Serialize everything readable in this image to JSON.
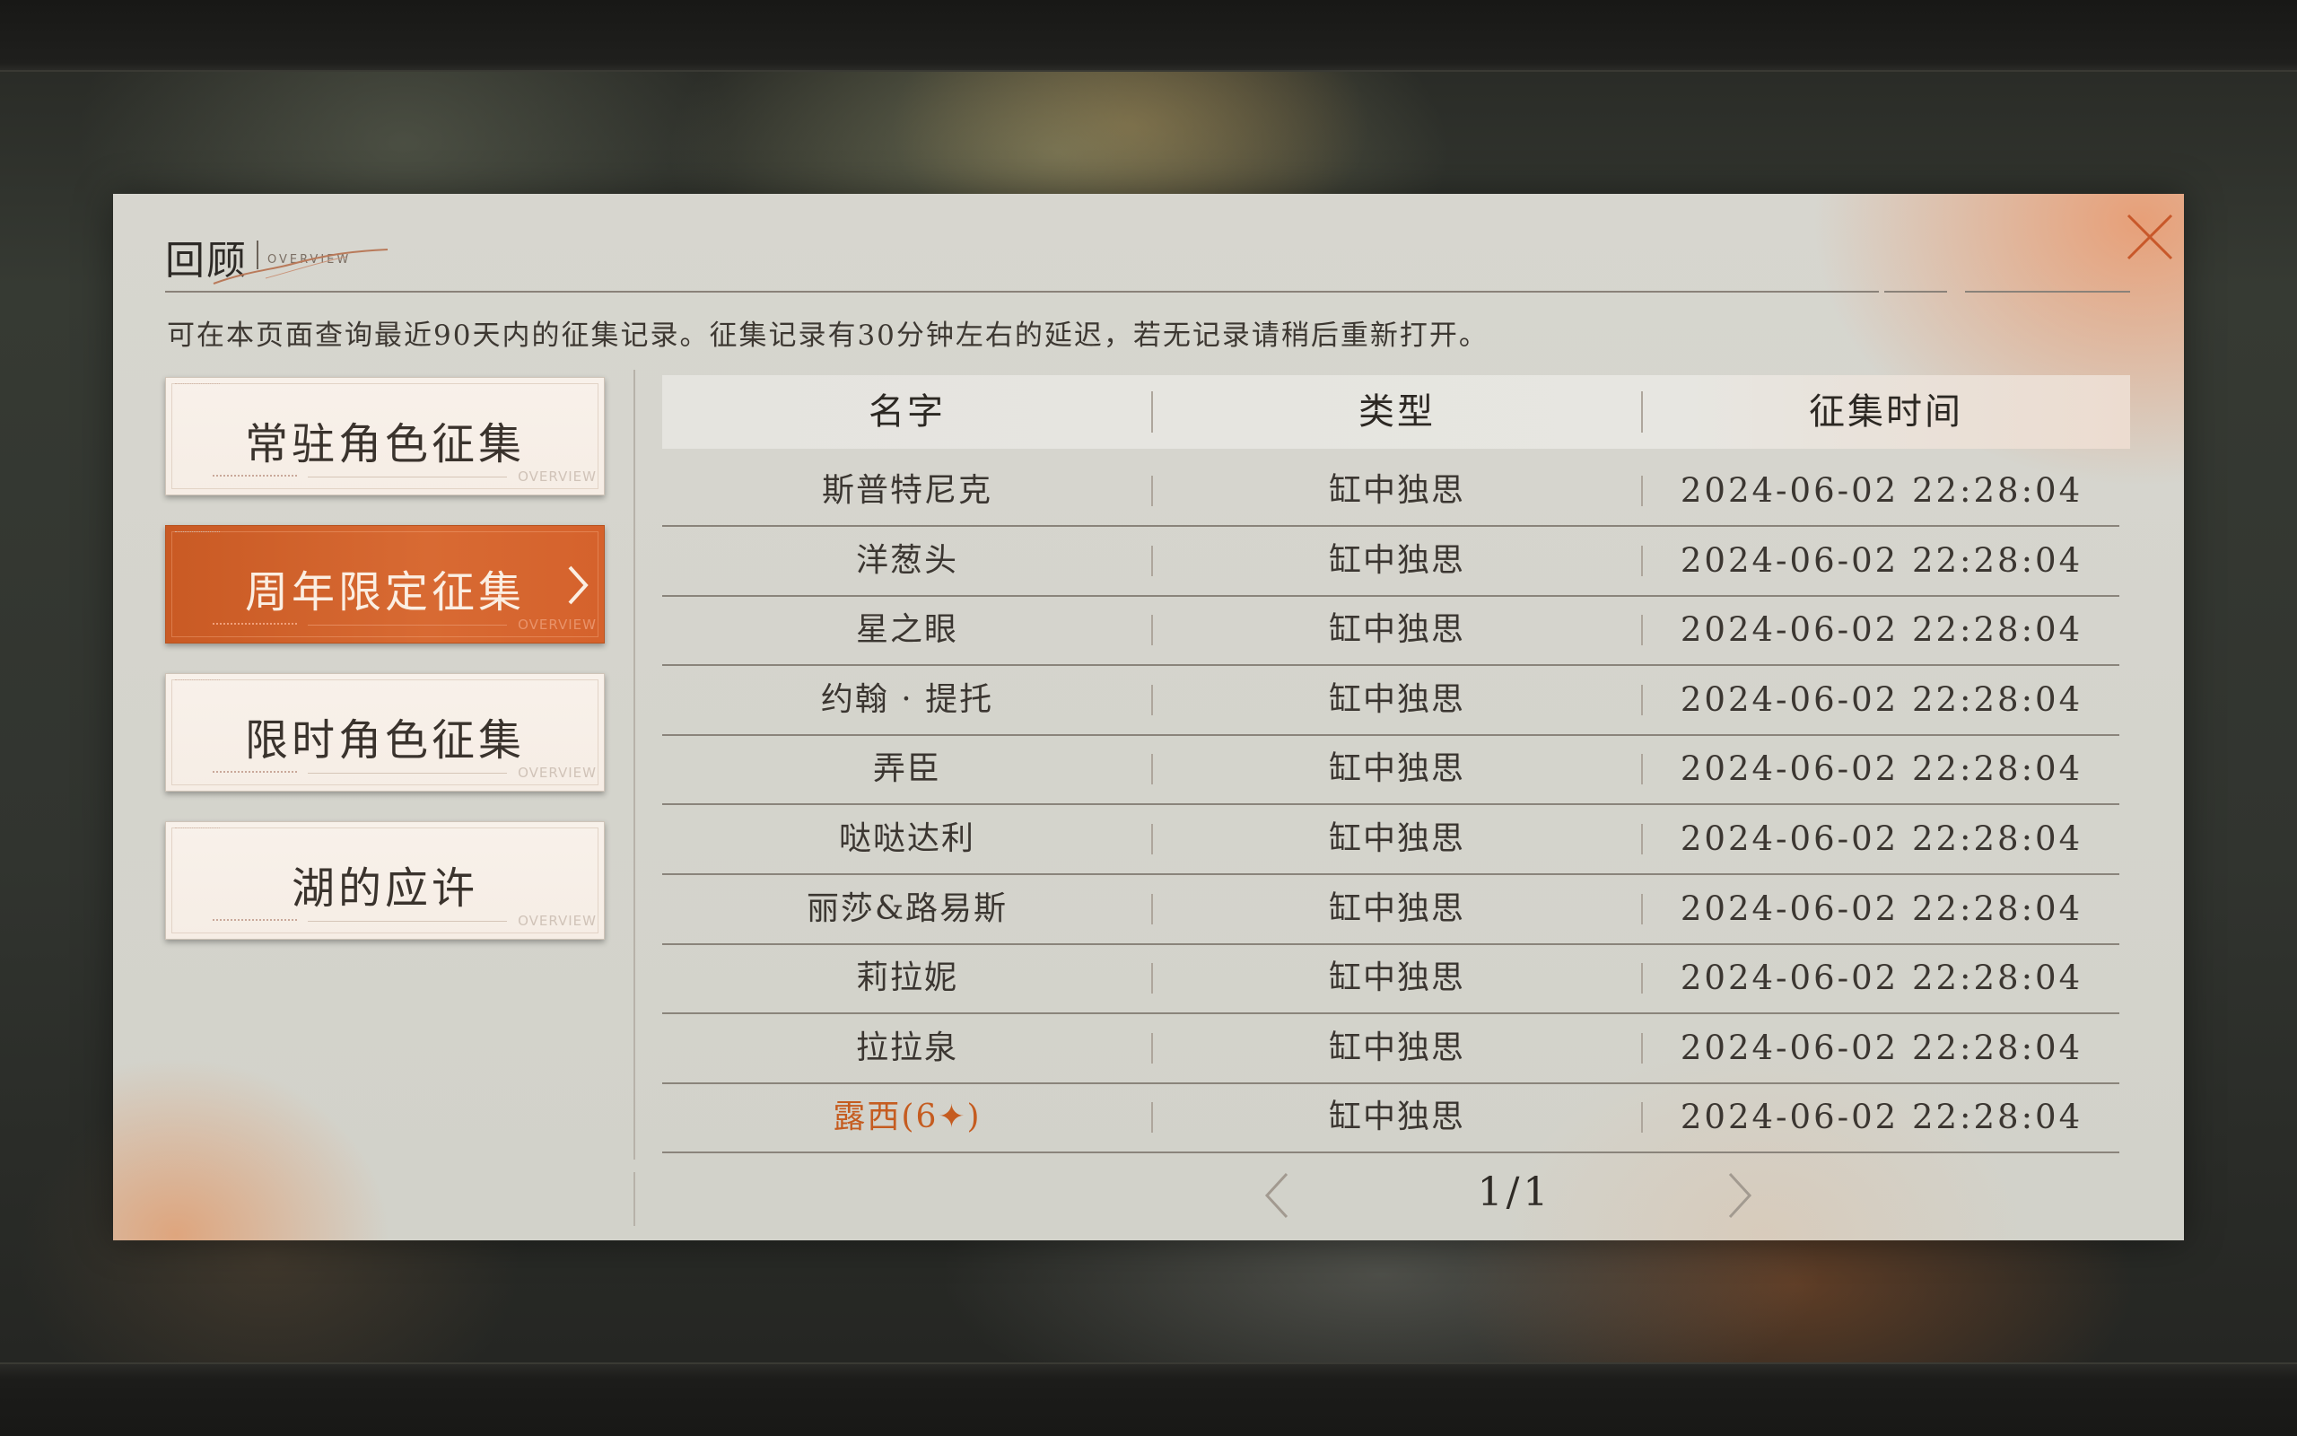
{
  "header": {
    "title": "回顾",
    "subtitle": "OVERVIEW"
  },
  "notice": "可在本页面查询最近90天内的征集记录。征集记录有30分钟左右的延迟，若无记录请稍后重新打开。",
  "sidebar": {
    "items": [
      {
        "label": "常驻角色征集",
        "active": false,
        "tag": "OVERVIEW"
      },
      {
        "label": "周年限定征集",
        "active": true,
        "tag": "OVERVIEW"
      },
      {
        "label": "限时角色征集",
        "active": false,
        "tag": "OVERVIEW"
      },
      {
        "label": "湖的应许",
        "active": false,
        "tag": "OVERVIEW"
      }
    ]
  },
  "table": {
    "columns": [
      "名字",
      "类型",
      "征集时间"
    ],
    "rows": [
      {
        "name": "斯普特尼克",
        "type": "缸中独思",
        "time": "2024-06-02 22:28:04"
      },
      {
        "name": "洋葱头",
        "type": "缸中独思",
        "time": "2024-06-02 22:28:04"
      },
      {
        "name": "星之眼",
        "type": "缸中独思",
        "time": "2024-06-02 22:28:04"
      },
      {
        "name": "约翰 · 提托",
        "type": "缸中独思",
        "time": "2024-06-02 22:28:04"
      },
      {
        "name": "弄臣",
        "type": "缸中独思",
        "time": "2024-06-02 22:28:04"
      },
      {
        "name": "哒哒达利",
        "type": "缸中独思",
        "time": "2024-06-02 22:28:04"
      },
      {
        "name": "丽莎&路易斯",
        "type": "缸中独思",
        "time": "2024-06-02 22:28:04"
      },
      {
        "name": "莉拉妮",
        "type": "缸中独思",
        "time": "2024-06-02 22:28:04"
      },
      {
        "name": "拉拉泉",
        "type": "缸中独思",
        "time": "2024-06-02 22:28:04"
      },
      {
        "name": "露西(6✦)",
        "type": "缸中独思",
        "time": "2024-06-02 22:28:04",
        "highlight": true
      }
    ]
  },
  "pagination": {
    "label": "1/1"
  },
  "colors": {
    "accent": "#d0622b",
    "highlight_text": "#c55c20",
    "panel": "#d4d3cc"
  },
  "icons": {
    "close": "close-icon",
    "prev": "chevron-left-icon",
    "next": "chevron-right-icon",
    "active_item": "chevron-right-icon"
  }
}
